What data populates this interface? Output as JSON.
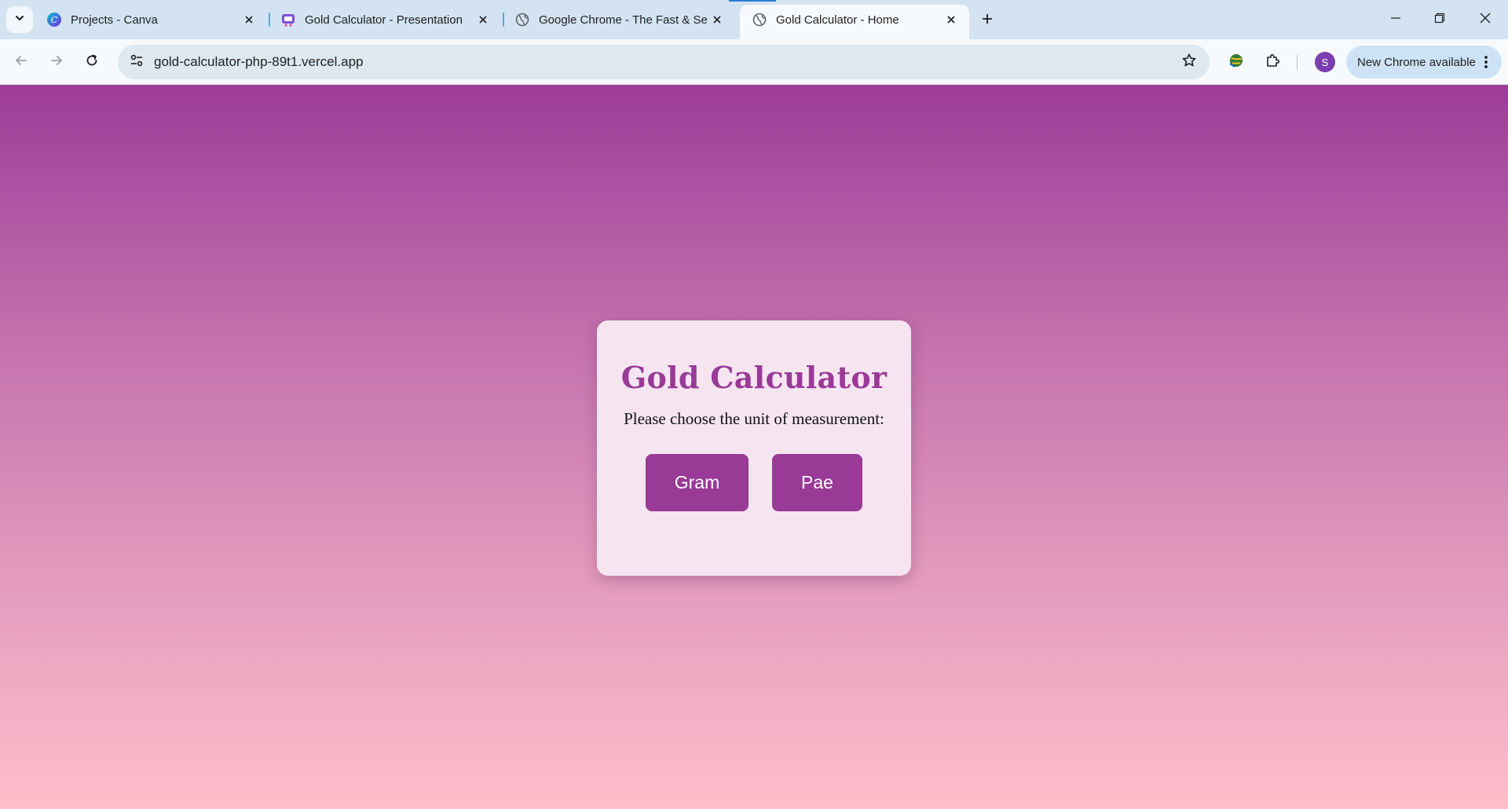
{
  "browser": {
    "tabs": [
      {
        "title": "Projects - Canva",
        "favicon": "canva-icon",
        "active": false
      },
      {
        "title": "Gold Calculator - Presentation",
        "favicon": "presentation-icon",
        "active": false
      },
      {
        "title": "Google Chrome - The Fast & Se",
        "favicon": "globe-icon",
        "active": false
      },
      {
        "title": "Gold Calculator - Home",
        "favicon": "globe-icon",
        "active": true
      }
    ],
    "url": "gold-calculator-php-89t1.vercel.app",
    "profile_initial": "S",
    "update_label": "New Chrome available"
  },
  "page": {
    "heading": "Gold Calculator",
    "prompt": "Please choose the unit of measurement:",
    "buttons": {
      "gram": "Gram",
      "pae": "Pae"
    }
  },
  "colors": {
    "brand": "#9a3a97",
    "gradient_top": "#9d3c99",
    "gradient_bottom": "#ffbecb",
    "card_bg": "#f6e5f1"
  }
}
